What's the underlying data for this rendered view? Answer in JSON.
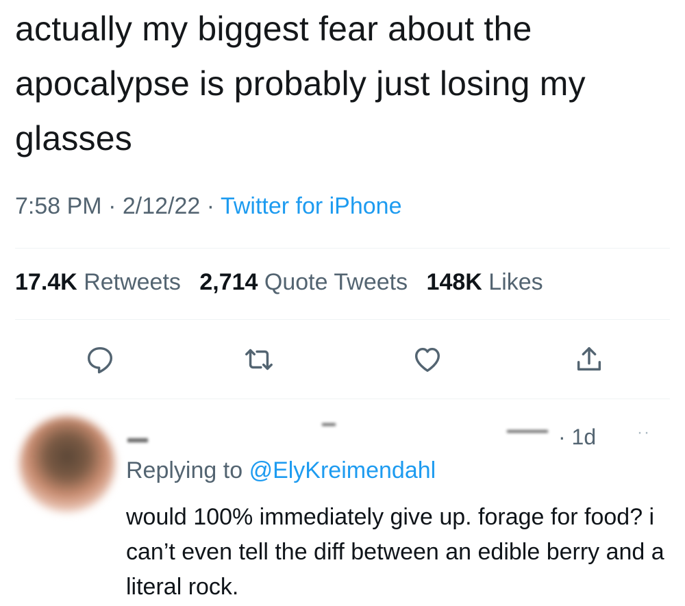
{
  "tweet": {
    "text": "actually my biggest fear about the apocalypse is probably just losing my glasses",
    "time": "7:58 PM",
    "date": "2/12/22",
    "separator": "·",
    "source": "Twitter for iPhone"
  },
  "stats": {
    "retweets_count": "17.4K",
    "retweets_label": "Retweets",
    "quotes_count": "2,714",
    "quotes_label": "Quote Tweets",
    "likes_count": "148K",
    "likes_label": "Likes"
  },
  "actions": [
    {
      "icon": "reply-icon"
    },
    {
      "icon": "retweet-icon"
    },
    {
      "icon": "like-icon"
    },
    {
      "icon": "share-icon"
    }
  ],
  "reply": {
    "time": "· 1d",
    "more": "··",
    "replying_prefix": "Replying to",
    "replying_handle": "@ElyKreimendahl",
    "text": "would 100% immediately give up. forage for food? i can’t even tell the diff between an edible berry and a literal rock."
  },
  "colors": {
    "accent": "#1d9bf0",
    "secondary_text": "#536471",
    "primary_text": "#0f1419",
    "divider": "#eff3f4"
  }
}
